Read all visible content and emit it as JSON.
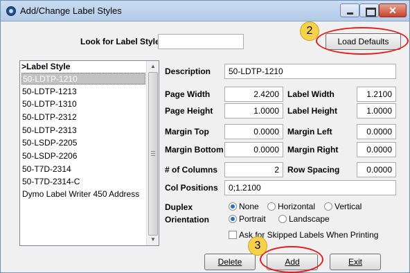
{
  "window": {
    "title": "Add/Change Label Styles",
    "close_glyph": "✕"
  },
  "search": {
    "label": "Look for Label Style",
    "value": ""
  },
  "toolbar": {
    "load_defaults_label": "Load Defaults"
  },
  "list": {
    "header": ">Label Style",
    "items": [
      "50-LDTP-1210",
      "50-LDTP-1213",
      "50-LDTP-1310",
      "50-LDTP-2312",
      "50-LDTP-2313",
      "50-LSDP-2205",
      "50-LSDP-2206",
      "50-T7D-2314",
      "50-T7D-2314-C",
      "Dymo Label Writer 450 Address"
    ],
    "selected_index": 0
  },
  "form": {
    "description_label": "Description",
    "description_value": "50-LDTP-1210",
    "page_width_label": "Page Width",
    "page_width_value": "2.4200",
    "label_width_label": "Label Width",
    "label_width_value": "1.2100",
    "page_height_label": "Page Height",
    "page_height_value": "1.0000",
    "label_height_label": "Label Height",
    "label_height_value": "1.0000",
    "margin_top_label": "Margin Top",
    "margin_top_value": "0.0000",
    "margin_left_label": "Margin Left",
    "margin_left_value": "0.0000",
    "margin_bottom_label": "Margin Bottom",
    "margin_bottom_value": "0.0000",
    "margin_right_label": "Margin Right",
    "margin_right_value": "0.0000",
    "columns_label": "# of Columns",
    "columns_value": "2",
    "row_spacing_label": "Row Spacing",
    "row_spacing_value": "0.0000",
    "col_positions_label": "Col Positions",
    "col_positions_value": "0;1.2100",
    "duplex_label": "Duplex",
    "duplex_options": [
      "None",
      "Horizontal",
      "Vertical"
    ],
    "duplex_selected": "None",
    "orientation_label": "Orientation",
    "orientation_options": [
      "Portrait",
      "Landscape"
    ],
    "orientation_selected": "Portrait",
    "skip_labels_text": "Ask for Skipped Labels When Printing",
    "skip_labels_checked": false
  },
  "buttons": {
    "delete": "Delete",
    "add": "Add",
    "exit": "Exit"
  },
  "annotations": {
    "step_2": "2",
    "step_3": "3",
    "bubble_color": "#f6d24a",
    "ring_color": "#e21d1d"
  }
}
